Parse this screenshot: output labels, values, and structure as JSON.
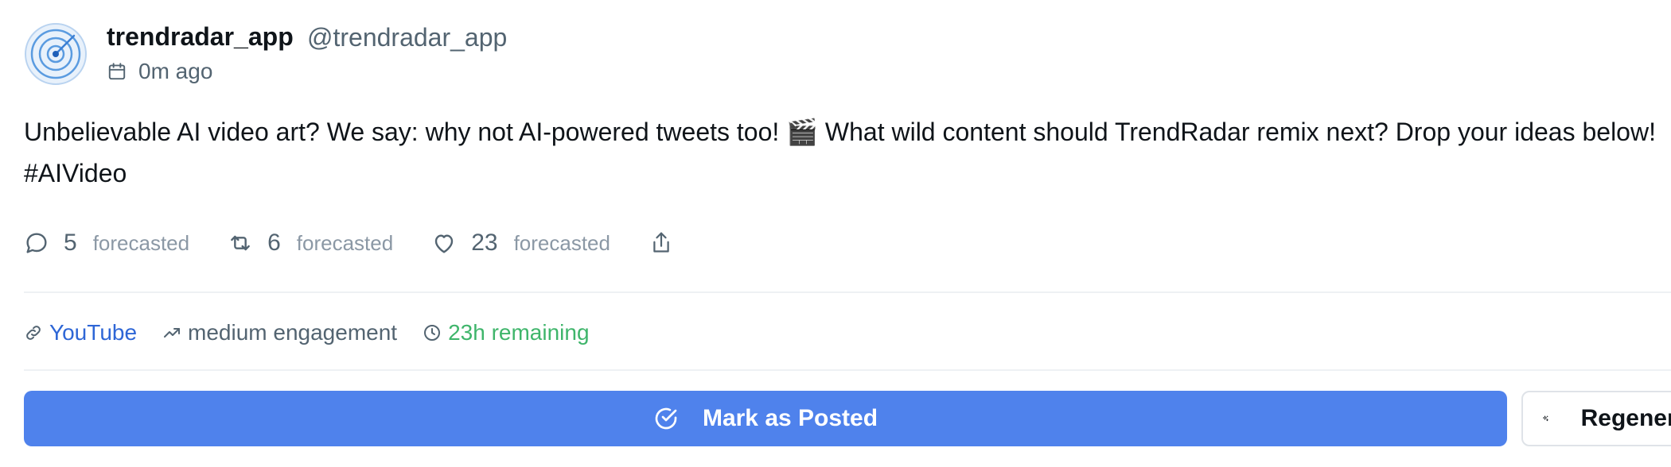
{
  "author": {
    "name": "trendradar_app",
    "handle": "@trendradar_app",
    "avatar_icon": "radar-icon",
    "posted_time": "0m ago"
  },
  "tweet": {
    "line1": "Unbelievable AI video art? We say: why not AI-powered tweets too! 🎬 What wild content should TrendRadar remix next? Drop your ideas below!",
    "line2": "#AIVideo"
  },
  "metrics": {
    "replies": {
      "count": "5",
      "label": "forecasted",
      "icon": "reply-icon"
    },
    "retweets": {
      "count": "6",
      "label": "forecasted",
      "icon": "retweet-icon"
    },
    "likes": {
      "count": "23",
      "label": "forecasted",
      "icon": "heart-icon"
    },
    "share_icon": "share-icon"
  },
  "meta": {
    "source": "YouTube",
    "engagement": "medium engagement",
    "remaining": "23h remaining"
  },
  "actions": {
    "mark_posted": "Mark as Posted",
    "regenerate": "Regenerate"
  },
  "colors": {
    "primary": "#4f82ec",
    "link": "#2e66d6",
    "remaining": "#3fb56b",
    "muted": "#536471"
  }
}
